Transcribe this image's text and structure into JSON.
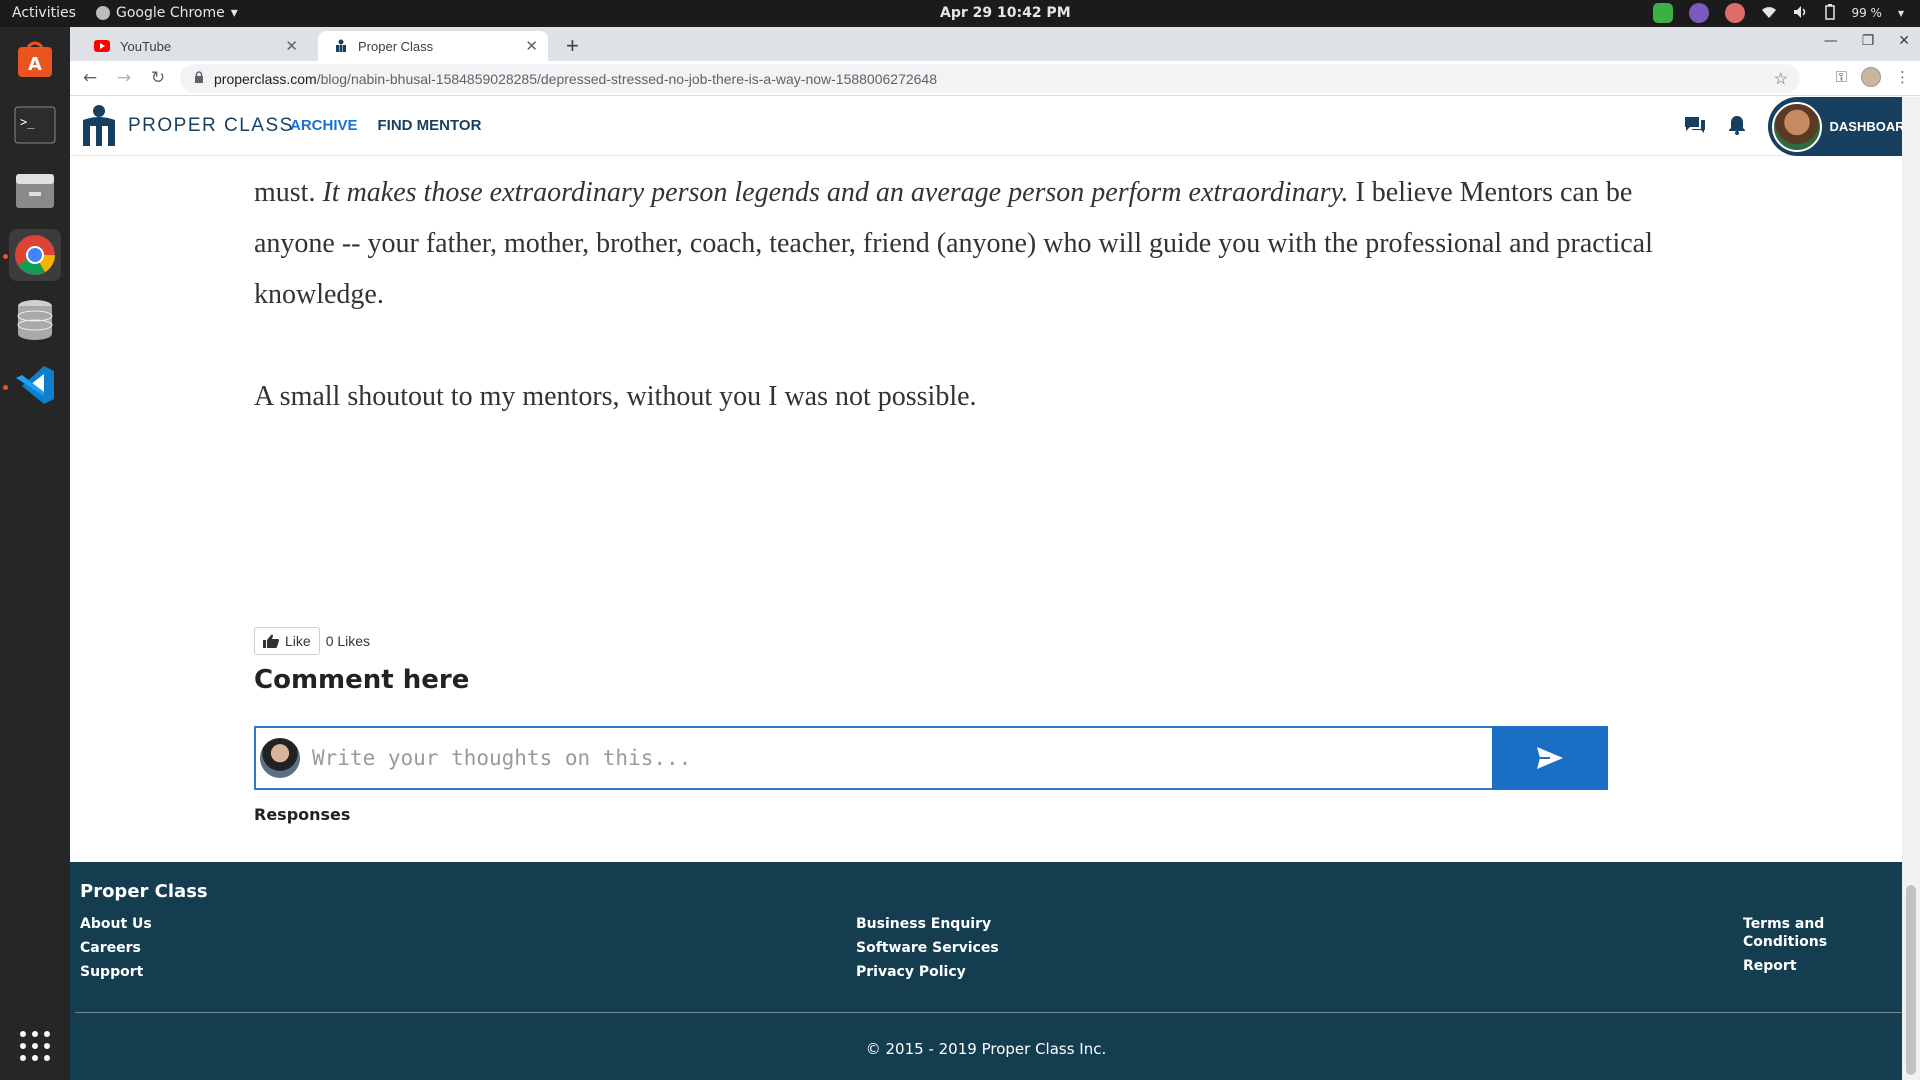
{
  "system": {
    "activities": "Activities",
    "app_name": "Google Chrome",
    "clock": "Apr 29  10:42 PM",
    "battery": "99 %"
  },
  "browser": {
    "tabs": [
      {
        "label": "YouTube",
        "icon": "youtube-icon"
      },
      {
        "label": "Proper Class",
        "icon": "properclass-icon"
      }
    ],
    "url_domain": "properclass.com",
    "url_path": "/blog/nabin-bhusal-1584859028285/depressed-stressed-no-job-there-is-a-way-now-1588006272648"
  },
  "site": {
    "logo_text": "PROPER CLASS",
    "nav": {
      "archive": "ARCHIVE",
      "find_mentor": "FIND MENTOR"
    },
    "dashboard": "DASHBOARD"
  },
  "article": {
    "p1_start": "must. ",
    "p1_italic": "It makes those extraordinary person legends and an average person perform extraordinary.",
    "p1_end": " I believe Mentors can be anyone -- your father, mother, brother, coach, teacher, friend (anyone) who will guide you with the professional and practical knowledge.",
    "p2": "A small shoutout to my mentors, without you I was not possible."
  },
  "engagement": {
    "like_label": "Like",
    "likes_count": "0 Likes",
    "comment_title": "Comment here",
    "comment_placeholder": "Write your thoughts on this...",
    "responses_label": "Responses"
  },
  "footer": {
    "brand": "Proper Class",
    "col1": [
      "About Us",
      "Careers",
      "Support"
    ],
    "col2": [
      "Business Enquiry",
      "Software Services",
      "Privacy Policy"
    ],
    "col3": [
      "Terms and Conditions",
      "Report"
    ],
    "copyright": "© 2015 - 2019 Proper Class Inc."
  },
  "colors": {
    "brand_navy": "#173f5f",
    "accent_blue": "#1a6fc4",
    "footer_bg": "#153d50"
  }
}
